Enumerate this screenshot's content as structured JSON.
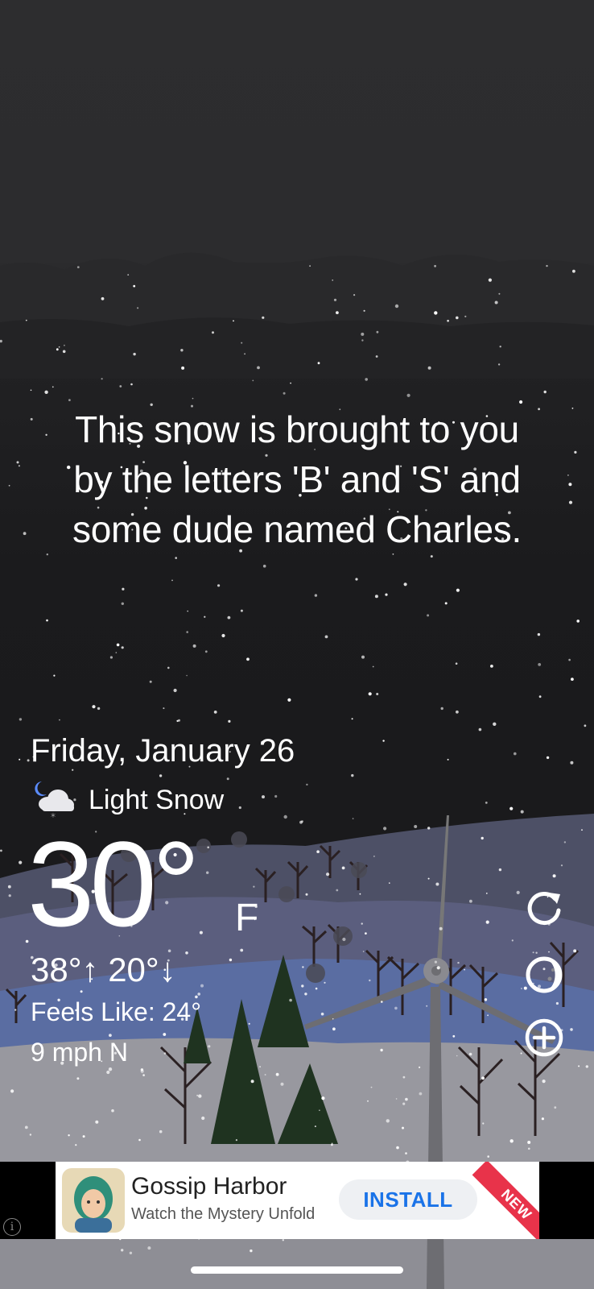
{
  "message": {
    "line1": "This snow is brought to you",
    "line2": "by the letters 'B' and 'S' and",
    "line3": "some dude named Charles."
  },
  "weather": {
    "date": "Friday, January 26",
    "condition": "Light Snow",
    "condition_icon": "moon-cloud-snow-icon",
    "temperature": "30°",
    "unit": "F",
    "high": "38°",
    "low": "20°",
    "feels_like": "Feels Like: 24°",
    "wind": "9 mph N"
  },
  "controls": {
    "refresh_icon": "refresh-icon",
    "theme_icon": "theme-toggle-icon",
    "add_icon": "add-location-icon"
  },
  "ad": {
    "title": "Gossip Harbor",
    "subtitle": "Watch the Mystery Unfold",
    "cta": "INSTALL",
    "ribbon": "NEW",
    "info": "i"
  },
  "colors": {
    "sky_top": "#2d2d2f",
    "sky_bottom": "#1a1a1c",
    "snow_ground": "#9a9aa2",
    "hills": "#5b5e7e",
    "trees": "#1f3320",
    "install_text": "#1a73e8",
    "ribbon": "#e8334a"
  }
}
